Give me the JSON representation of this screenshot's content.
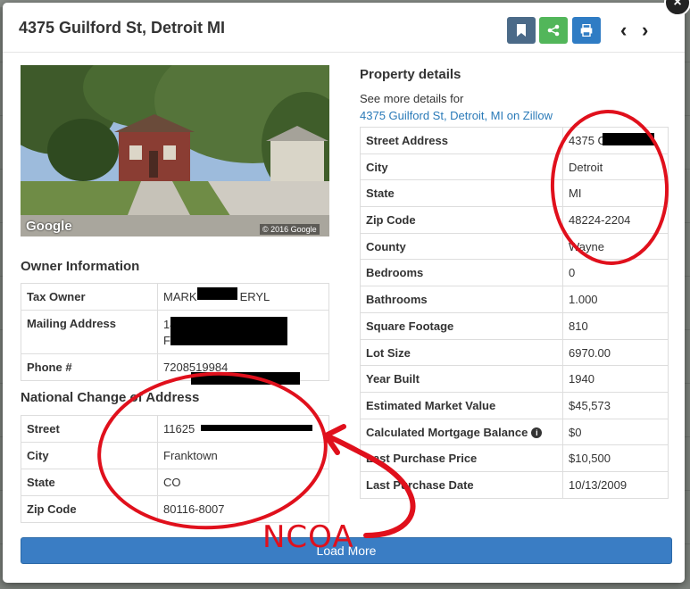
{
  "modal": {
    "title": "4375 Guilford St, Detroit MI",
    "close_label": "×",
    "prev_label": "‹",
    "next_label": "›",
    "actions": [
      {
        "icon": "bookmark-icon",
        "color": "#4b6a88"
      },
      {
        "icon": "share-icon",
        "color": "#52b65a"
      },
      {
        "icon": "print-icon",
        "color": "#2f7cc4"
      }
    ]
  },
  "street_view": {
    "logo": "Google",
    "copyright": "© 2016 Google"
  },
  "owner": {
    "title": "Owner Information",
    "rows": [
      {
        "label": "Tax Owner",
        "value": "MARK",
        "value2": "ERYL"
      },
      {
        "label": "Mailing Address",
        "value": "14",
        "value2": "Fr"
      },
      {
        "label": "Phone #",
        "value": "7208519984"
      }
    ]
  },
  "ncoa": {
    "title": "National Change of Address",
    "rows": [
      {
        "label": "Street",
        "value": "11625"
      },
      {
        "label": "City",
        "value": "Franktown"
      },
      {
        "label": "State",
        "value": "CO"
      },
      {
        "label": "Zip Code",
        "value": "80116-8007"
      }
    ]
  },
  "property": {
    "title": "Property details",
    "subtitle": "See more details for",
    "link": "4375 Guilford St, Detroit, MI on Zillow",
    "rows": [
      {
        "label": "Street Address",
        "value": "4375 G"
      },
      {
        "label": "City",
        "value": "Detroit"
      },
      {
        "label": "State",
        "value": "MI"
      },
      {
        "label": "Zip Code",
        "value": "48224-2204"
      },
      {
        "label": "County",
        "value": "Wayne"
      },
      {
        "label": "Bedrooms",
        "value": "0"
      },
      {
        "label": "Bathrooms",
        "value": "1.000"
      },
      {
        "label": "Square Footage",
        "value": "810"
      },
      {
        "label": "Lot Size",
        "value": "6970.00"
      },
      {
        "label": "Year Built",
        "value": "1940"
      },
      {
        "label": "Estimated Market Value",
        "value": "$45,573"
      },
      {
        "label": "Calculated Mortgage Balance",
        "value": "$0"
      },
      {
        "label": "Last Purchase Price",
        "value": "$10,500"
      },
      {
        "label": "Last Purchase Date",
        "value": "10/13/2009"
      }
    ]
  },
  "load_more_label": "Load More",
  "annotation": {
    "text": "NCOA",
    "color": "#e0101c"
  }
}
